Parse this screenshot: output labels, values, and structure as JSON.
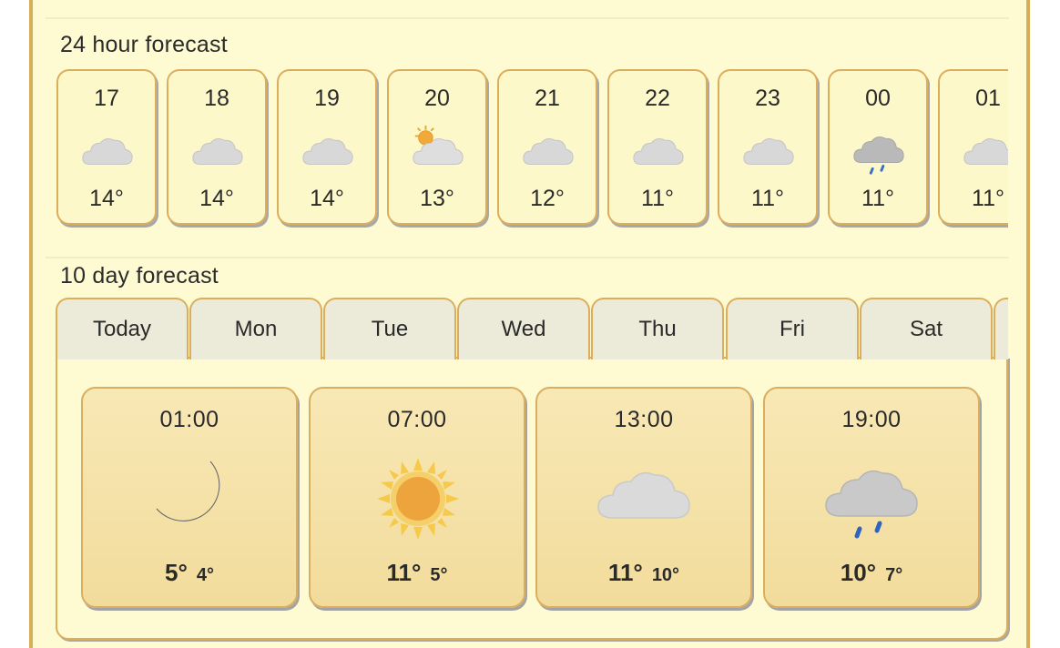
{
  "hourly": {
    "title": "24 hour forecast",
    "hours": [
      {
        "time": "17",
        "icon": "cloud-icon",
        "temp": "14°"
      },
      {
        "time": "18",
        "icon": "cloud-icon",
        "temp": "14°"
      },
      {
        "time": "19",
        "icon": "cloud-icon",
        "temp": "14°"
      },
      {
        "time": "20",
        "icon": "sun-behind-cloud-icon",
        "temp": "13°"
      },
      {
        "time": "21",
        "icon": "cloud-icon",
        "temp": "12°"
      },
      {
        "time": "22",
        "icon": "cloud-icon",
        "temp": "11°"
      },
      {
        "time": "23",
        "icon": "cloud-icon",
        "temp": "11°"
      },
      {
        "time": "00",
        "icon": "rain-cloud-icon",
        "temp": "11°"
      },
      {
        "time": "01",
        "icon": "cloud-icon",
        "temp": "11°"
      }
    ]
  },
  "daily": {
    "title": "10 day forecast",
    "tabs": [
      "Today",
      "Mon",
      "Tue",
      "Wed",
      "Thu",
      "Fri",
      "Sat",
      ""
    ],
    "selected_tab": "Today",
    "periods": [
      {
        "time": "01:00",
        "icon": "moon-icon",
        "high": "5°",
        "low": "4°"
      },
      {
        "time": "07:00",
        "icon": "sun-icon",
        "high": "11°",
        "low": "5°"
      },
      {
        "time": "13:00",
        "icon": "cloud-icon",
        "high": "11°",
        "low": "10°"
      },
      {
        "time": "19:00",
        "icon": "rain-cloud-icon",
        "high": "10°",
        "low": "7°"
      }
    ]
  },
  "colors": {
    "panel_bg": "#fefbd3",
    "border": "#d8ae58",
    "tab_bg": "#ecebd9",
    "card_bg": "#f5e2a8"
  }
}
